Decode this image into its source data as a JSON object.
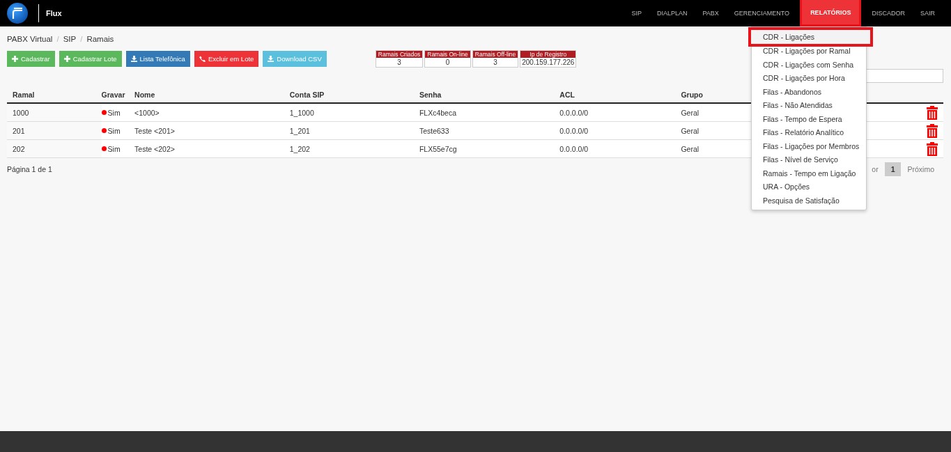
{
  "brand": {
    "title": "Flux"
  },
  "nav": [
    {
      "label": "SIP",
      "selected": false,
      "highlighted": false
    },
    {
      "label": "DIALPLAN",
      "selected": false,
      "highlighted": false
    },
    {
      "label": "PABX",
      "selected": false,
      "highlighted": false
    },
    {
      "label": "GERENCIAMENTO",
      "selected": false,
      "highlighted": false
    },
    {
      "label": "RELATÓRIOS",
      "selected": true,
      "highlighted": true
    },
    {
      "label": "DISCADOR",
      "selected": false,
      "highlighted": false
    },
    {
      "label": "SAIR",
      "selected": false,
      "highlighted": false
    }
  ],
  "breadcrumb": [
    {
      "kind": "link",
      "text": "PABX Virtual"
    },
    {
      "kind": "separator",
      "text": "/"
    },
    {
      "kind": "link",
      "text": "SIP"
    },
    {
      "kind": "separator",
      "text": "/"
    },
    {
      "kind": "link",
      "text": "Ramais"
    }
  ],
  "actions": [
    {
      "label": "Cadastrar",
      "kind": "add",
      "color": "#5cb85c"
    },
    {
      "label": "Cadastrar Lote",
      "kind": "add",
      "color": "#5cb85c"
    },
    {
      "label": "Lista Telefônica",
      "kind": "download",
      "color": "#337ab7"
    },
    {
      "label": "Excluir em Lote",
      "kind": "phone",
      "color": "#ee3338"
    },
    {
      "label": "Download CSV",
      "kind": "download",
      "color": "#5bc0de"
    }
  ],
  "stats": [
    {
      "label": "Ramais Criados",
      "value": "3"
    },
    {
      "label": "Ramais On-line",
      "value": "0"
    },
    {
      "label": "Ramais Off-line",
      "value": "3"
    },
    {
      "label": "Ip de Registro",
      "value": "200.159.177.226"
    }
  ],
  "table": {
    "columns": [
      "Ramal",
      "Gravar",
      "Nome",
      "Conta SIP",
      "Senha",
      "ACL",
      "Grupo"
    ],
    "rows": [
      {
        "ramal": "1000",
        "recording": true,
        "gravar": "Sim",
        "nome": "<1000>",
        "conta": "1_1000",
        "senha": "FLXc4beca",
        "acl": "0.0.0.0/0",
        "grupo": "Geral"
      },
      {
        "ramal": "201",
        "recording": true,
        "gravar": "Sim",
        "nome": "Teste <201>",
        "conta": "1_201",
        "senha": "Teste633",
        "acl": "0.0.0.0/0",
        "grupo": "Geral"
      },
      {
        "ramal": "202",
        "recording": true,
        "gravar": "Sim",
        "nome": "Teste <202>",
        "conta": "1_202",
        "senha": "FLX55e7cg",
        "acl": "0.0.0.0/0",
        "grupo": "Geral"
      }
    ]
  },
  "page_info": "Página 1 de 1",
  "pagination": [
    {
      "label": "or",
      "selected": false
    },
    {
      "label": "1",
      "selected": true
    },
    {
      "label": "Próximo",
      "selected": false
    }
  ],
  "dropdown": [
    {
      "label": "CDR - Ligações",
      "highlighted": true
    },
    {
      "label": "CDR - Ligações por Ramal",
      "highlighted": false
    },
    {
      "label": "CDR - Ligações com Senha",
      "highlighted": false
    },
    {
      "label": "CDR - Ligações por Hora",
      "highlighted": false
    },
    {
      "label": "Filas - Abandonos",
      "highlighted": false
    },
    {
      "label": "Filas - Não Atendidas",
      "highlighted": false
    },
    {
      "label": "Filas - Tempo de Espera",
      "highlighted": false
    },
    {
      "label": "Filas - Relatório Analítico",
      "highlighted": false
    },
    {
      "label": "Filas - Ligações por Membros",
      "highlighted": false
    },
    {
      "label": "Filas - Nível de Serviço",
      "highlighted": false
    },
    {
      "label": "Ramais - Tempo em Ligação",
      "highlighted": false
    },
    {
      "label": "URA - Opções",
      "highlighted": false
    },
    {
      "label": "Pesquisa de Satisfação",
      "highlighted": false
    }
  ]
}
